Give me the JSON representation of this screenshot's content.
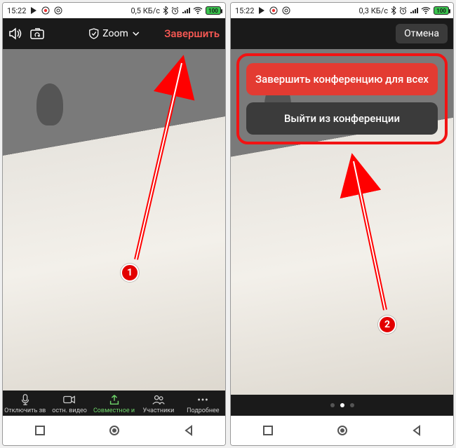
{
  "status": {
    "time": "15:22",
    "net1": "0,5 КБ/с",
    "net2": "0,3 КБ/с",
    "battery": "100"
  },
  "appbar": {
    "title": "Zoom",
    "end": "Завершить",
    "cancel": "Отмена"
  },
  "dialog": {
    "end_all": "Завершить конференцию для всех",
    "leave": "Выйти из конференции"
  },
  "toolbar": {
    "mute": "Отключить зв",
    "video": "остн. видео",
    "share": "Совместное и",
    "participants": "Участники",
    "more": "Подробнее"
  },
  "callouts": {
    "one": "1",
    "two": "2"
  }
}
